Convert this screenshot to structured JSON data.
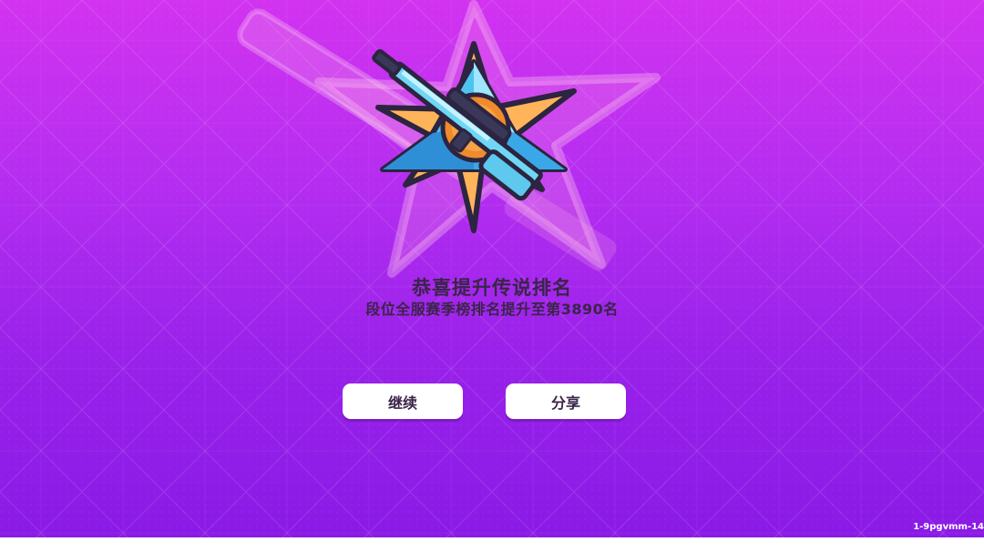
{
  "colors": {
    "background_top": "#d233f0",
    "background_bottom": "#8a1ae6",
    "text": "#3a2548",
    "button_bg": "#ffffff",
    "badge_blue": "#4fc3f0",
    "badge_orange": "#f08a2a"
  },
  "badge": {
    "icon": "legend-rank-sniper-rifle-badge-icon"
  },
  "promotion": {
    "title": "恭喜提升传说排名",
    "subtitle": "段位全服赛季榜排名提升至第3890名"
  },
  "buttons": {
    "continue_label": "继续",
    "share_label": "分享"
  },
  "build_id": "1-9pgvmm-14"
}
